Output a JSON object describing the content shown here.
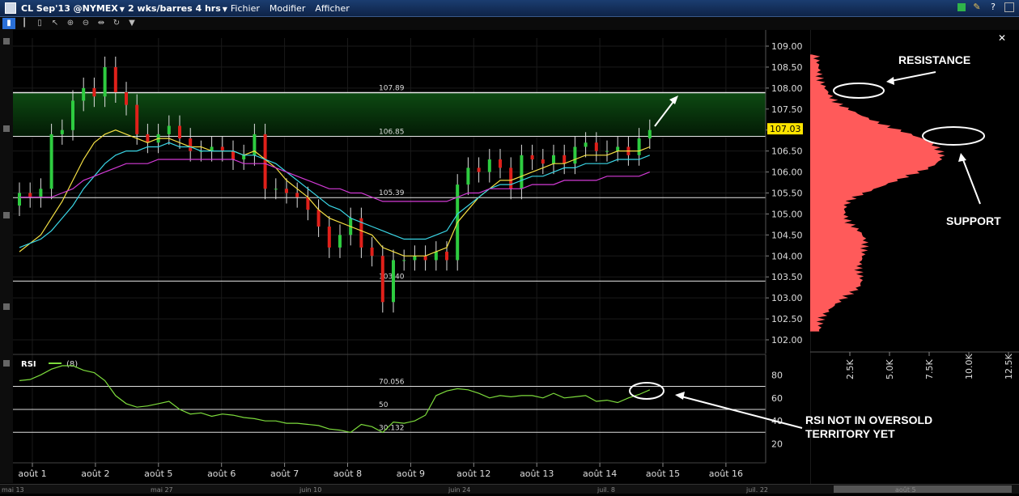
{
  "menu": {
    "symbol": "CL Sep'13 @NYMEX",
    "period": "2 wks/barres 4 hrs",
    "items": [
      "Fichier",
      "Modifier",
      "Afficher"
    ]
  },
  "price_axis": {
    "ticks": [
      "109.00",
      "108.50",
      "108.00",
      "107.50",
      "107.00",
      "106.50",
      "106.00",
      "105.50",
      "105.00",
      "104.50",
      "104.00",
      "103.50",
      "103.00",
      "102.50",
      "102.00"
    ],
    "current_price": "107.03"
  },
  "levels": {
    "l1": "107.89",
    "l2": "106.85",
    "l3": "105.39",
    "l4": "103.40"
  },
  "rsi": {
    "title": "RSI",
    "param": "(8)",
    "ticks": [
      "80",
      "60",
      "40",
      "20"
    ],
    "levels": {
      "upper": "70.056",
      "mid": "50",
      "lower": "30.132"
    }
  },
  "date_axis": {
    "labels": [
      "août 1",
      "août 2",
      "août 5",
      "août 6",
      "août 7",
      "août 8",
      "août 9",
      "août 12",
      "août 13",
      "août 14",
      "août 15",
      "août 16"
    ]
  },
  "overview_axis": {
    "labels": [
      "mai 13",
      "mai 27",
      "juin 10",
      "juin 24",
      "juil. 8",
      "juil. 22",
      "août 5"
    ]
  },
  "profile_axis": {
    "ticks": [
      "2.5K",
      "5.0K",
      "7.5K",
      "10.0K",
      "12.5K"
    ]
  },
  "annotations": {
    "resistance": "RESISTANCE",
    "support": "SUPPORT",
    "rsi_note_line1": "RSI NOT IN OVERSOLD",
    "rsi_note_line2": "TERRITORY YET"
  },
  "colors": {
    "background": "#000000",
    "menubar": "#0e2347",
    "up": "#2ecc40",
    "down": "#e0201a",
    "ma_fast": "#f5e044",
    "ma_mid": "#3ad6e6",
    "ma_slow": "#d33ad6",
    "profile": "#ff5a5a",
    "rsi_line": "#7ddc3c",
    "price_tag": "#ffe400"
  },
  "chart_data": {
    "type": "candlestick",
    "x": [
      "08-01 00",
      "08-01 04",
      "08-01 08",
      "08-01 12",
      "08-01 16",
      "08-01 20",
      "08-02 00",
      "08-02 04",
      "08-02 08",
      "08-02 12",
      "08-02 16",
      "08-02 20",
      "08-05 00",
      "08-05 04",
      "08-05 08",
      "08-05 12",
      "08-05 16",
      "08-05 20",
      "08-06 00",
      "08-06 04",
      "08-06 08",
      "08-06 12",
      "08-06 16",
      "08-06 20",
      "08-07 00",
      "08-07 04",
      "08-07 08",
      "08-07 12",
      "08-07 16",
      "08-07 20",
      "08-08 00",
      "08-08 04",
      "08-08 08",
      "08-08 12",
      "08-08 16",
      "08-08 20",
      "08-09 00",
      "08-09 04",
      "08-09 08",
      "08-09 12",
      "08-09 16",
      "08-09 20",
      "08-12 00",
      "08-12 04",
      "08-12 08",
      "08-12 12",
      "08-12 16",
      "08-12 20",
      "08-13 00",
      "08-13 04",
      "08-13 08",
      "08-13 12",
      "08-13 16",
      "08-13 20",
      "08-14 00",
      "08-14 04",
      "08-14 08",
      "08-14 12",
      "08-14 16",
      "08-14 20"
    ],
    "close": [
      105.5,
      105.4,
      105.6,
      106.9,
      107.0,
      107.7,
      108.0,
      107.8,
      108.5,
      107.9,
      107.6,
      106.9,
      106.7,
      106.9,
      107.1,
      106.8,
      106.5,
      106.5,
      106.6,
      106.5,
      106.3,
      106.4,
      106.9,
      105.6,
      105.6,
      105.5,
      105.4,
      105.1,
      104.7,
      104.2,
      104.5,
      104.9,
      104.2,
      104.0,
      102.9,
      103.9,
      103.9,
      104.0,
      103.9,
      104.1,
      103.9,
      105.7,
      106.1,
      106.0,
      106.3,
      106.1,
      105.6,
      106.4,
      106.3,
      106.2,
      106.4,
      106.2,
      106.6,
      106.7,
      106.5,
      106.5,
      106.6,
      106.4,
      106.8,
      107.0
    ],
    "series": [
      {
        "name": "ma_fast",
        "values": [
          104.1,
          104.3,
          104.5,
          104.9,
          105.3,
          105.8,
          106.3,
          106.7,
          106.9,
          107.0,
          106.9,
          106.8,
          106.7,
          106.8,
          106.8,
          106.7,
          106.6,
          106.6,
          106.5,
          106.5,
          106.5,
          106.4,
          106.5,
          106.3,
          106.1,
          105.8,
          105.6,
          105.4,
          105.1,
          104.9,
          104.8,
          104.7,
          104.6,
          104.5,
          104.2,
          104.1,
          104.0,
          104.0,
          104.0,
          104.1,
          104.2,
          104.8,
          105.1,
          105.4,
          105.6,
          105.8,
          105.8,
          105.9,
          106.0,
          106.1,
          106.2,
          106.2,
          106.3,
          106.4,
          106.4,
          106.4,
          106.5,
          106.5,
          106.5,
          106.6
        ]
      },
      {
        "name": "ma_mid",
        "values": [
          104.2,
          104.3,
          104.4,
          104.6,
          104.9,
          105.2,
          105.6,
          105.9,
          106.2,
          106.4,
          106.5,
          106.5,
          106.6,
          106.6,
          106.7,
          106.6,
          106.6,
          106.5,
          106.5,
          106.5,
          106.5,
          106.4,
          106.4,
          106.3,
          106.2,
          106.0,
          105.8,
          105.6,
          105.4,
          105.2,
          105.1,
          104.9,
          104.8,
          104.7,
          104.6,
          104.5,
          104.4,
          104.4,
          104.4,
          104.5,
          104.6,
          105.0,
          105.2,
          105.4,
          105.6,
          105.7,
          105.7,
          105.8,
          105.9,
          105.9,
          106.0,
          106.1,
          106.1,
          106.2,
          106.2,
          106.2,
          106.3,
          106.3,
          106.3,
          106.4
        ]
      },
      {
        "name": "ma_slow",
        "values": [
          105.4,
          105.4,
          105.4,
          105.4,
          105.5,
          105.6,
          105.8,
          105.9,
          106.0,
          106.1,
          106.2,
          106.2,
          106.2,
          106.3,
          106.3,
          106.3,
          106.3,
          106.3,
          106.3,
          106.3,
          106.3,
          106.2,
          106.2,
          106.2,
          106.1,
          106.0,
          105.9,
          105.8,
          105.7,
          105.6,
          105.6,
          105.5,
          105.5,
          105.4,
          105.3,
          105.3,
          105.3,
          105.3,
          105.3,
          105.3,
          105.3,
          105.4,
          105.5,
          105.5,
          105.6,
          105.6,
          105.6,
          105.6,
          105.7,
          105.7,
          105.7,
          105.8,
          105.8,
          105.8,
          105.8,
          105.9,
          105.9,
          105.9,
          105.9,
          106.0
        ]
      }
    ],
    "rsi_values": [
      75,
      76,
      80,
      85,
      88,
      88,
      84,
      82,
      75,
      62,
      55,
      52,
      53,
      55,
      57,
      50,
      46,
      47,
      44,
      46,
      45,
      43,
      42,
      40,
      40,
      38,
      38,
      37,
      36,
      33,
      32,
      30,
      37,
      35,
      30,
      39,
      38,
      40,
      45,
      62,
      66,
      68,
      67,
      64,
      60,
      62,
      61,
      62,
      62,
      60,
      64,
      60,
      61,
      62,
      57,
      58,
      56,
      60,
      63,
      67
    ],
    "ylim": [
      102.0,
      109.0
    ]
  }
}
